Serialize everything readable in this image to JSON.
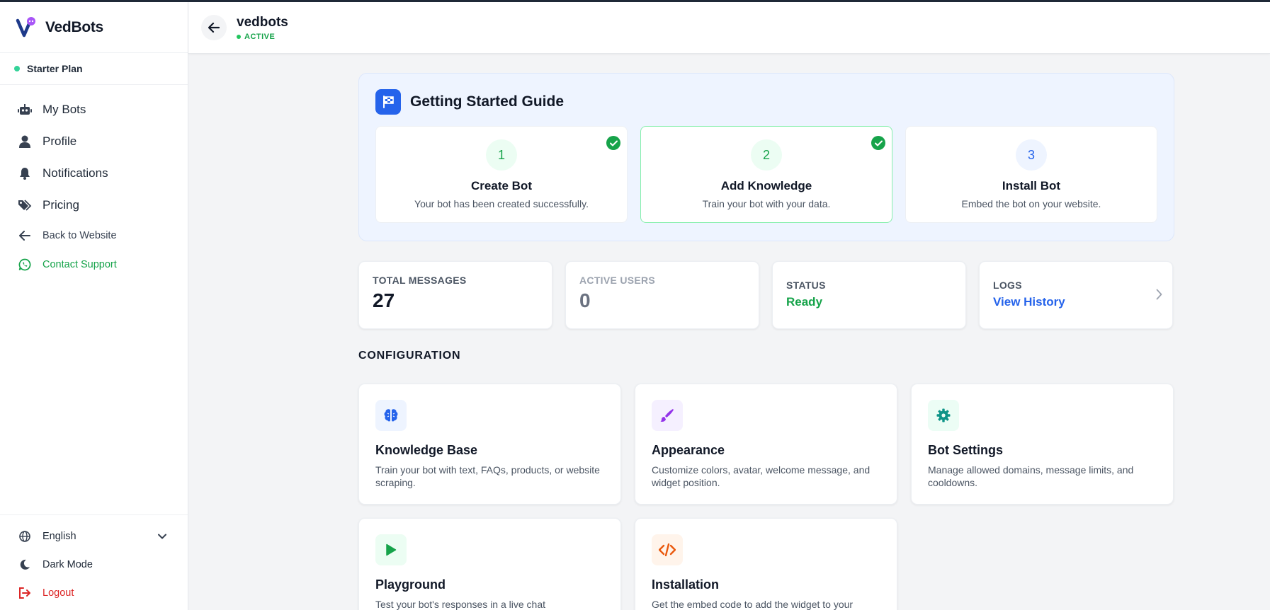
{
  "brand": {
    "name": "VedBots"
  },
  "plan": {
    "label": "Starter Plan"
  },
  "sidebar": {
    "items": [
      {
        "label": "My Bots"
      },
      {
        "label": "Profile"
      },
      {
        "label": "Notifications"
      },
      {
        "label": "Pricing"
      },
      {
        "label": "Back to Website"
      },
      {
        "label": "Contact Support"
      }
    ],
    "bottom": {
      "language": "English",
      "dark_mode": "Dark Mode",
      "logout": "Logout"
    }
  },
  "header": {
    "bot_name": "vedbots",
    "status": "ACTIVE"
  },
  "guide": {
    "title": "Getting Started Guide",
    "steps": [
      {
        "number": "1",
        "title": "Create Bot",
        "desc": "Your bot has been created successfully.",
        "done": true
      },
      {
        "number": "2",
        "title": "Add Knowledge",
        "desc": "Train your bot with your data.",
        "done": true
      },
      {
        "number": "3",
        "title": "Install Bot",
        "desc": "Embed the bot on your website.",
        "done": false
      }
    ]
  },
  "stats": {
    "total_messages": {
      "label": "TOTAL MESSAGES",
      "value": "27"
    },
    "active_users": {
      "label": "ACTIVE USERS",
      "value": "0"
    },
    "status": {
      "label": "STATUS",
      "value": "Ready"
    },
    "logs": {
      "label": "LOGS",
      "value": "View History"
    }
  },
  "configuration": {
    "title": "CONFIGURATION",
    "cards": [
      {
        "title": "Knowledge Base",
        "desc": "Train your bot with text, FAQs, products, or website scraping."
      },
      {
        "title": "Appearance",
        "desc": "Customize colors, avatar, welcome message, and widget position."
      },
      {
        "title": "Bot Settings",
        "desc": "Manage allowed domains, message limits, and cooldowns."
      },
      {
        "title": "Playground",
        "desc": "Test your bot's responses in a live chat"
      },
      {
        "title": "Installation",
        "desc": "Get the embed code to add the widget to your"
      }
    ]
  },
  "colors": {
    "accent": "#2563eb",
    "success": "#16a34a",
    "danger": "#dc2626",
    "guide_bg": "#eef4ff"
  }
}
